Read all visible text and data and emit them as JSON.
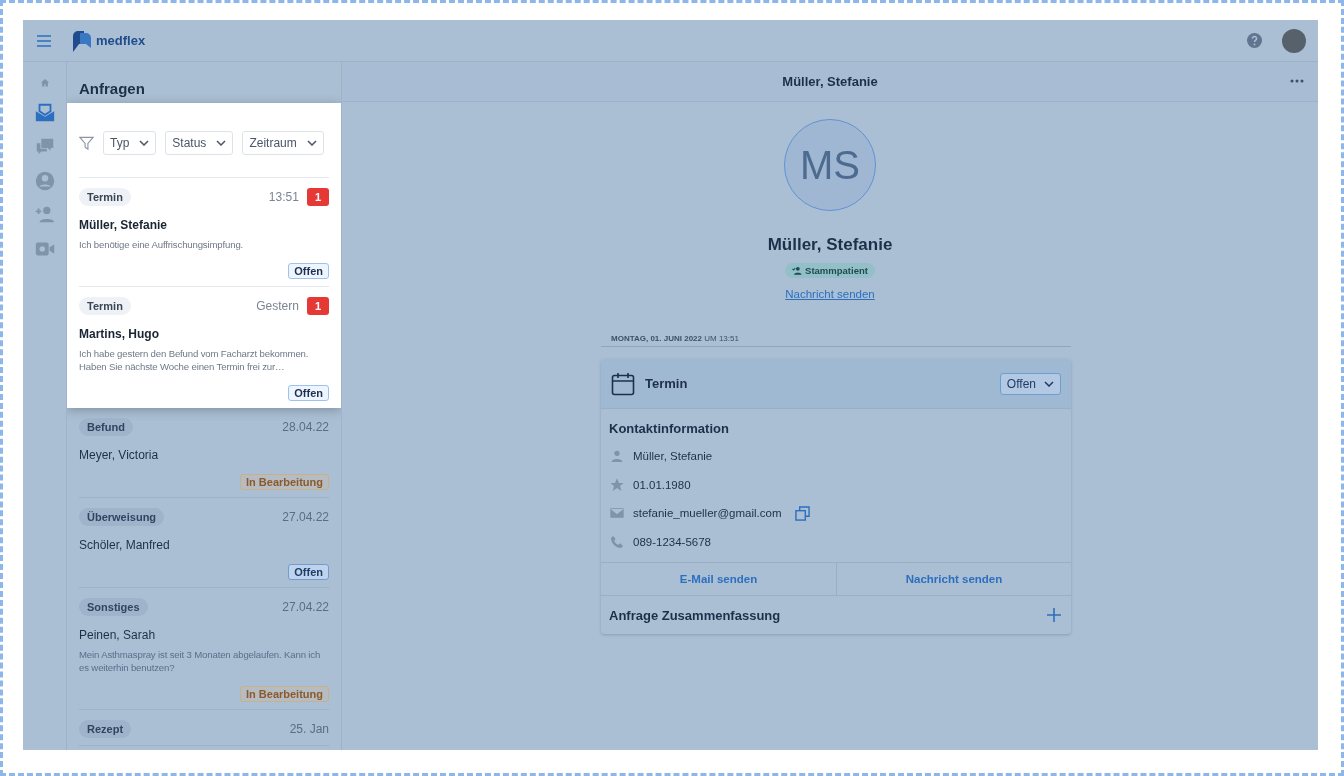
{
  "top_bar": {
    "brand": "medflex"
  },
  "nav": [
    {
      "selected": false
    },
    {
      "selected": true
    },
    {
      "selected": false
    },
    {
      "selected": false
    },
    {
      "selected": false
    },
    {
      "selected": false
    }
  ],
  "list": {
    "title": "Anfragen",
    "filters": [
      "Typ",
      "Status",
      "Zeitraum"
    ],
    "spotlight_requests": [
      {
        "type": "Termin",
        "time": "13:51",
        "unread": "1",
        "name": "Müller, Stefanie",
        "message": "Ich benötige eine Auffrischungsimpfung.",
        "status": "Offen",
        "kind": "open"
      },
      {
        "type": "Termin",
        "time": "Gestern",
        "unread": "1",
        "name": "Martins, Hugo",
        "message": "Ich habe gestern den Befund vom Facharzt bekommen. Haben Sie nächste Woche einen Termin frei zur…",
        "status": "Offen",
        "kind": "open"
      }
    ],
    "requests": [
      {
        "type": "Befund",
        "time": "28.04.22",
        "name": "Meyer, Victoria",
        "status": "In Bearbeitung",
        "kind": "in_progress"
      },
      {
        "type": "Überweisung",
        "time": "27.04.22",
        "name": "Schöler, Manfred",
        "status": "Offen",
        "kind": "open"
      },
      {
        "type": "Sonstiges",
        "time": "27.04.22",
        "name": "Peinen, Sarah",
        "message": "Mein Asthmaspray ist seit 3 Monaten abgelaufen. Kann ich es weiterhin benutzen?",
        "status": "In Bearbeitung",
        "kind": "in_progress"
      },
      {
        "type": "Rezept",
        "time": "25. Jan"
      }
    ]
  },
  "detail": {
    "header_title": "Müller, Stefanie",
    "initials": "MS",
    "name": "Müller, Stefanie",
    "badge": "Stammpatient",
    "link": "Nachricht senden",
    "date_label": "**MONTAG, 01. JUNI 2022** UM 13:51",
    "card": {
      "title": "Termin",
      "status": "Offen",
      "section_title": "Kontaktinformation",
      "contacts": [
        {
          "kind": "person",
          "text": "Müller, Stefanie"
        },
        {
          "kind": "birthday",
          "text": "01.01.1980"
        },
        {
          "kind": "email",
          "text": "stefanie_mueller@gmail.com",
          "copy": true
        },
        {
          "kind": "phone",
          "text": "089-1234-5678"
        }
      ],
      "actions": [
        "E-Mail senden",
        "Nachricht senden"
      ],
      "summary": "Anfrage Zusammenfassung"
    }
  }
}
